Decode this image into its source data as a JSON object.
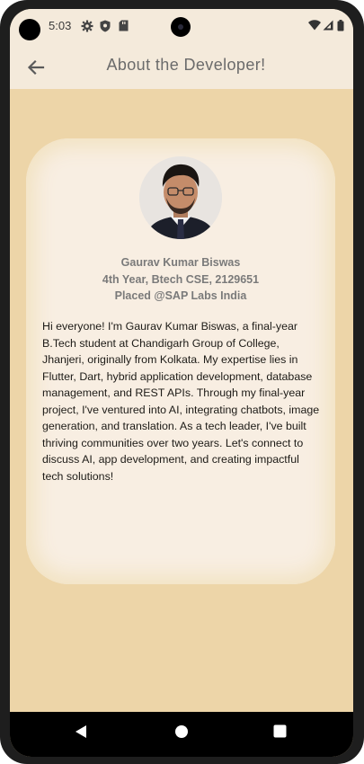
{
  "status_bar": {
    "time": "5:03",
    "left_icons": [
      "gear-icon",
      "shield-icon",
      "sd-card-icon"
    ],
    "right_icons": [
      "wifi-icon",
      "signal-icon",
      "battery-icon"
    ]
  },
  "app_bar": {
    "back_icon": "arrow-left-icon",
    "title": "About the Developer!"
  },
  "profile": {
    "name": "Gaurav Kumar Biswas",
    "details": "4th Year, Btech CSE, 2129651",
    "placement": "Placed @SAP Labs India",
    "bio": "Hi everyone! I'm Gaurav Kumar Biswas, a final-year B.Tech student at Chandigarh Group of College, Jhanjeri, originally from Kolkata. My expertise lies in Flutter, Dart, hybrid application development, database management, and REST APIs. Through my final-year project, I've ventured into AI, integrating chatbots, image generation, and translation. As a tech leader, I've built thriving communities over two years. Let's connect to discuss AI, app development, and creating impactful tech solutions!"
  },
  "nav_bar": {
    "buttons": [
      "back-triangle-icon",
      "home-circle-icon",
      "recents-square-icon"
    ]
  },
  "colors": {
    "background": "#edd5a8",
    "app_bar": "#f4eadb",
    "card": "#f8eee2",
    "title_text": "#6b6b6b"
  }
}
